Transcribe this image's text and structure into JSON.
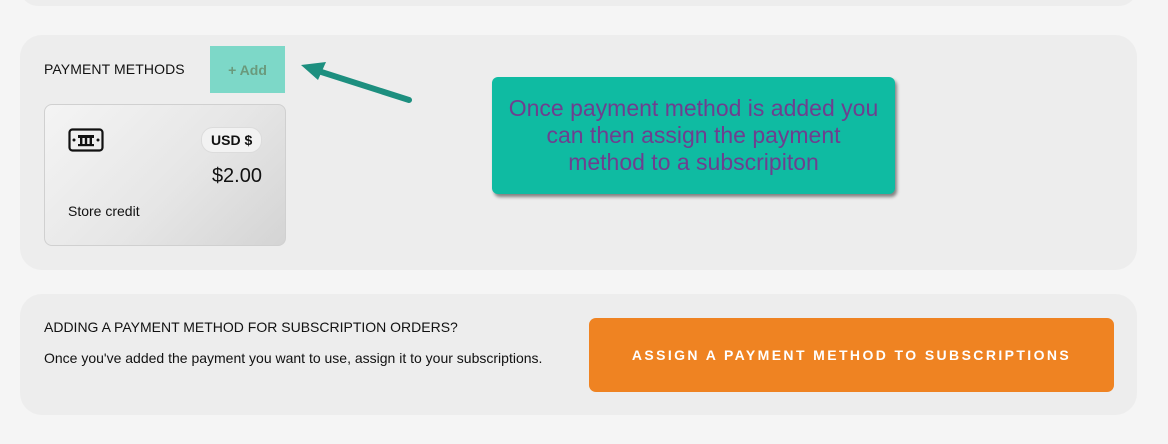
{
  "payment_methods": {
    "title": "PAYMENT METHODS",
    "add_label": "+ Add",
    "cards": [
      {
        "icon": "store-credit-icon",
        "currency": "USD $",
        "amount": "$2.00",
        "label": "Store credit"
      }
    ]
  },
  "callout": {
    "text": "Once payment method is added you can then assign the payment method to a subscripiton",
    "background": "#0fbba2",
    "text_color": "#6e3f8f"
  },
  "subscriptions": {
    "heading": "ADDING A PAYMENT METHOD FOR SUBSCRIPTION ORDERS?",
    "description": "Once you've added the payment you want to use, assign it to your subscriptions.",
    "button_label": "ASSIGN A PAYMENT METHOD TO SUBSCRIPTIONS",
    "button_color": "#ef8322"
  }
}
